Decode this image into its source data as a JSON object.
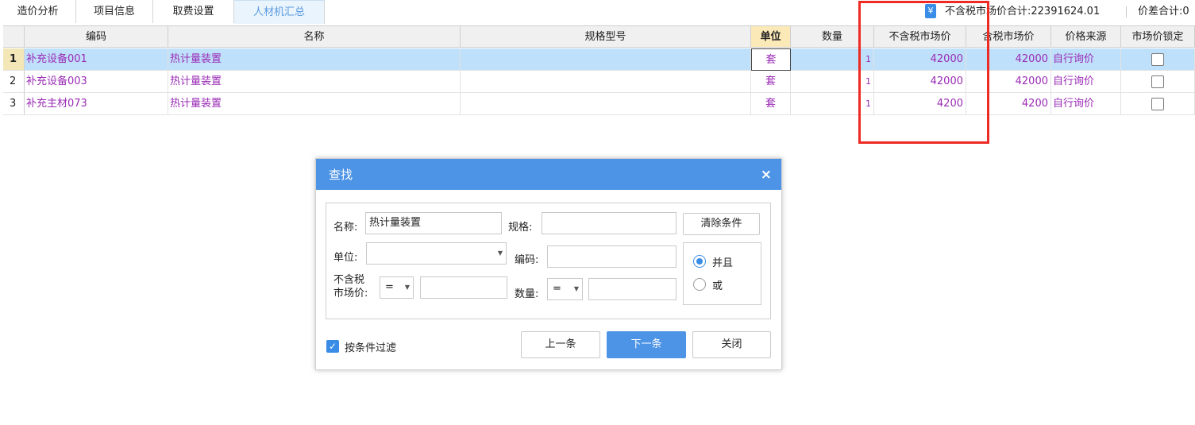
{
  "tabs": [
    {
      "label": "造价分析"
    },
    {
      "label": "项目信息"
    },
    {
      "label": "取费设置"
    },
    {
      "label": "人材机汇总"
    }
  ],
  "summary": {
    "pre_tax_total": "不含税市场价合计:22391624.01",
    "diff_total": "价差合计:0"
  },
  "table": {
    "headers": [
      "编码",
      "名称",
      "规格型号",
      "单位",
      "数量",
      "不含税市场价",
      "含税市场价",
      "价格来源",
      "市场价锁定"
    ],
    "rows": [
      {
        "no": "1",
        "code": "补充设备001",
        "name": "热计量装置",
        "spec": "",
        "unit": "套",
        "qty": "1",
        "pre_tax": "42000",
        "tax_incl": "42000",
        "source": "自行询价"
      },
      {
        "no": "2",
        "code": "补充设备003",
        "name": "热计量装置",
        "spec": "",
        "unit": "套",
        "qty": "1",
        "pre_tax": "42000",
        "tax_incl": "42000",
        "source": "自行询价"
      },
      {
        "no": "3",
        "code": "补充主材073",
        "name": "热计量装置",
        "spec": "",
        "unit": "套",
        "qty": "1",
        "pre_tax": "4200",
        "tax_incl": "4200",
        "source": "自行询价"
      }
    ]
  },
  "dialog": {
    "title": "查找",
    "close": "×",
    "name_label": "名称:",
    "name_value": "热计量装置",
    "spec_label": "规格:",
    "spec_value": "",
    "clear_button": "清除条件",
    "unit_label": "单位:",
    "code_label": "编码:",
    "price_label_1": "不含税",
    "price_label_2": "市场价:",
    "price_op": "=",
    "qty_label": "数量:",
    "qty_op": "=",
    "radio_and": "并且",
    "radio_or": "或",
    "filter_label": "按条件过滤",
    "prev_button": "上一条",
    "next_button": "下一条",
    "close_button": "关闭"
  },
  "colors": {
    "accent": "#4d94e6",
    "highlight_box": "#ee2a24",
    "data_text": "#9a2bb5",
    "selected_row": "#bfe0fb"
  }
}
